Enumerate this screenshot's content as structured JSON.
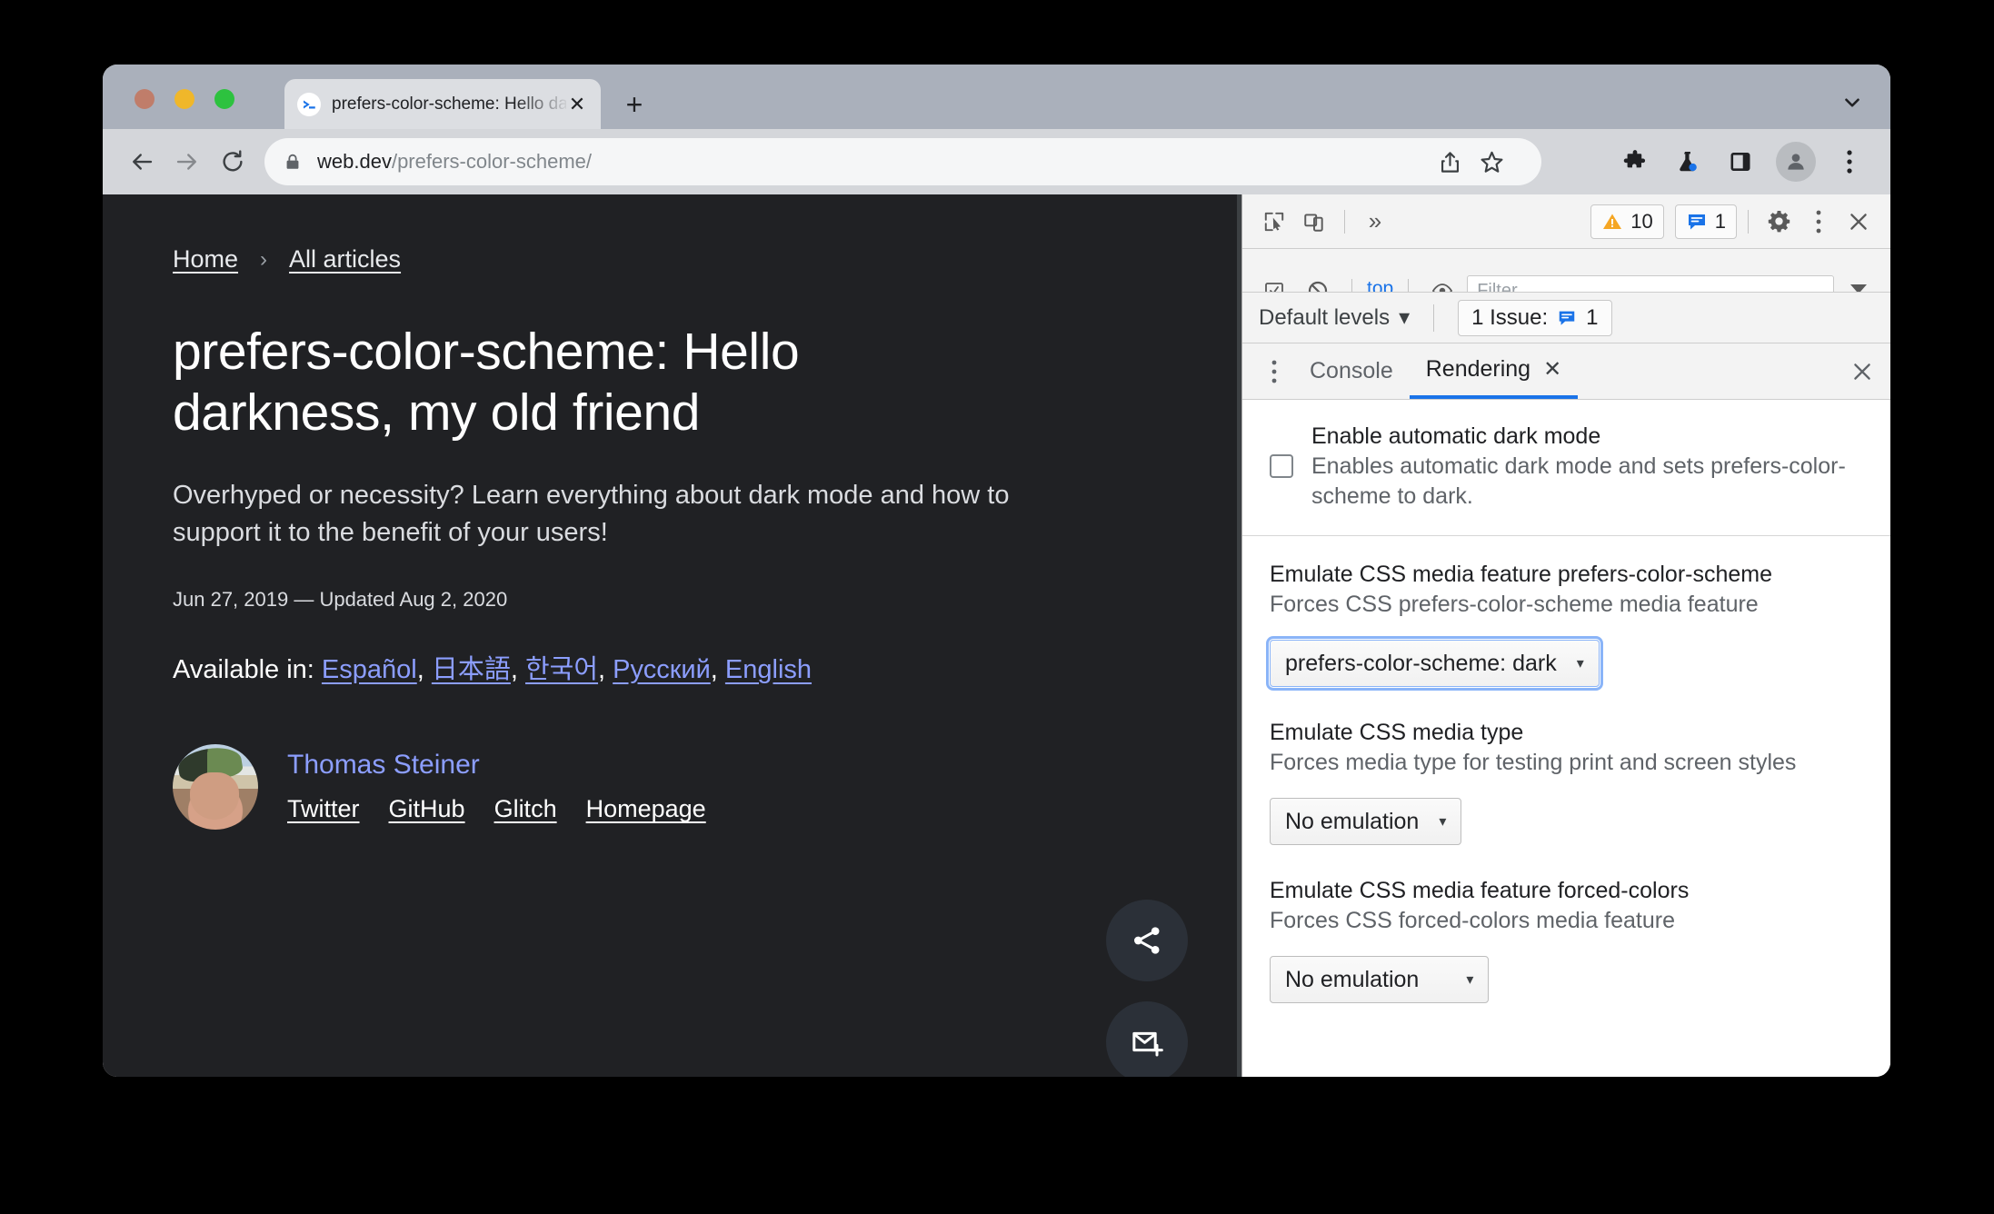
{
  "browser": {
    "tab": {
      "title": "prefers-color-scheme: Hello da",
      "favicon_name": "webdev-favicon",
      "close_label": "✕"
    },
    "new_tab_label": "+",
    "toolbar": {
      "back_label": "Back",
      "forward_label": "Forward",
      "reload_label": "Reload",
      "url_host": "web.dev",
      "url_path": "/prefers-color-scheme/",
      "share_label": "Share",
      "bookmark_label": "Bookmark",
      "extensions_label": "Extensions",
      "experiments_label": "Experiments",
      "side_panel_label": "Side panel",
      "profile_label": "Profile",
      "menu_label": "Customize and control Chrome"
    }
  },
  "page": {
    "breadcrumb": {
      "home": "Home",
      "separator": "›",
      "all_articles": "All articles"
    },
    "title": "prefers-color-scheme: Hello darkness, my old friend",
    "subtitle": "Overhyped or necessity? Learn everything about dark mode and how to support it to the benefit of your users!",
    "date": "Jun 27, 2019 — Updated Aug 2, 2020",
    "available_in_label": "Available in:",
    "languages": [
      {
        "label": "Español",
        "sep": ","
      },
      {
        "label": "日本語",
        "sep": ","
      },
      {
        "label": "한국어",
        "sep": ","
      },
      {
        "label": "Русский",
        "sep": ","
      },
      {
        "label": "English",
        "sep": ""
      }
    ],
    "author": {
      "name": "Thomas Steiner",
      "links": [
        "Twitter",
        "GitHub",
        "Glitch",
        "Homepage"
      ]
    },
    "fabs": [
      {
        "name": "share-fab"
      },
      {
        "name": "subscribe-fab"
      }
    ],
    "background_color": "#202124",
    "link_color": "#8c9eff"
  },
  "devtools": {
    "toolbar": {
      "inspect_label": "Inspect element",
      "device_toolbar_label": "Toggle device toolbar",
      "more_panels_label": "»",
      "warnings_count": "10",
      "issues_count": "1",
      "settings_label": "Settings",
      "more_options_label": "More options",
      "close_label": "✕"
    },
    "console_toolbar": {
      "context": "top",
      "filter_placeholder": "Filter"
    },
    "levels_row": {
      "levels_label": "Default levels",
      "caret": "▾",
      "issues_label": "1 Issue:",
      "issues_count": "1"
    },
    "tabs": {
      "more_label": "⋮",
      "items": [
        {
          "label": "Console",
          "active": false,
          "closable": false
        },
        {
          "label": "Rendering",
          "active": true,
          "closable": true
        }
      ],
      "close_label": "✕",
      "tab_close_label": "✕"
    },
    "settings": [
      {
        "title": "Enable automatic dark mode",
        "desc": "Enables automatic dark mode and sets prefers-color-scheme to dark.",
        "has_checkbox": true,
        "checked": false
      },
      {
        "title": "Emulate CSS media feature prefers-color-scheme",
        "desc": "Forces CSS prefers-color-scheme media feature",
        "select_value": "prefers-color-scheme: dark",
        "focused": true
      },
      {
        "title": "Emulate CSS media type",
        "desc": "Forces media type for testing print and screen styles",
        "select_value": "No emulation",
        "focused": false
      },
      {
        "title": "Emulate CSS media feature forced-colors",
        "desc": "Forces CSS forced-colors media feature",
        "select_value": "No emulation",
        "focused": false
      }
    ],
    "accent_color": "#1a73e8",
    "focus_ring_color": "#8ab4f8"
  }
}
